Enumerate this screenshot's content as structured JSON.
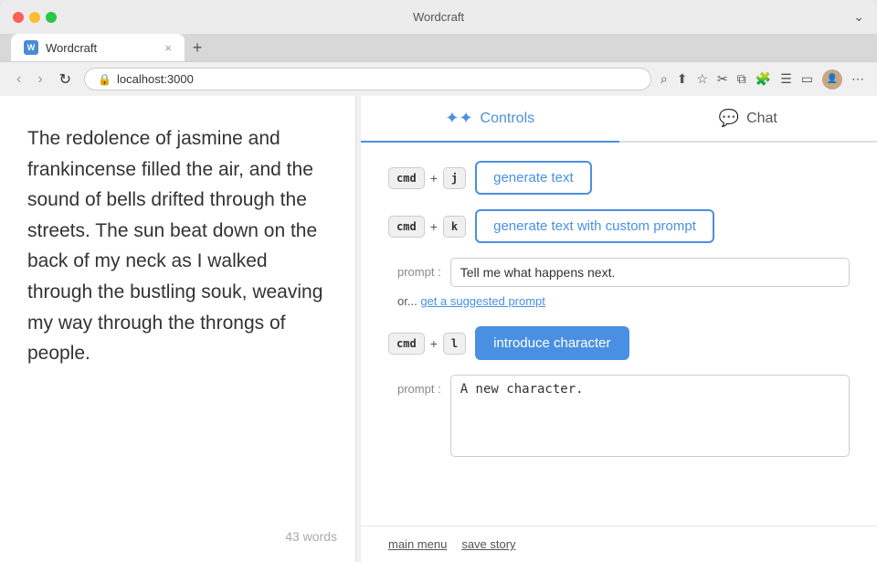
{
  "browser": {
    "tab_title": "Wordcraft",
    "url": "localhost:3000",
    "new_tab_label": "+",
    "tab_close": "×"
  },
  "nav": {
    "back": "‹",
    "forward": "›",
    "reload": "↻"
  },
  "toolbar": {
    "search_icon": "⌕",
    "share_icon": "⬆",
    "bookmark_icon": "★",
    "scissors_icon": "✂",
    "copy_icon": "⧉",
    "ext_icon": "🧩",
    "list_icon": "☰",
    "window_icon": "▭",
    "more_icon": "⋯"
  },
  "text_panel": {
    "story": "The redolence of jasmine and frankincense filled the air, and the sound of bells drifted through the streets. The sun beat down on the back of my neck as I walked through the bustling souk, weaving my way through the throngs of people.",
    "word_count": "43 words"
  },
  "controls": {
    "tab_controls_label": "Controls",
    "tab_chat_label": "Chat",
    "generate_text_label": "generate text",
    "generate_text_custom_label": "generate text with custom prompt",
    "introduce_character_label": "introduce character",
    "cmd_key": "cmd",
    "plus": "+",
    "key_j": "j",
    "key_k": "k",
    "key_l": "l",
    "prompt_label": "prompt :",
    "prompt_value": "Tell me what happens next.",
    "or_text": "or...",
    "suggest_link": "get a suggested prompt",
    "character_prompt_value": "A new character.",
    "main_menu_label": "main menu",
    "save_story_label": "save story"
  },
  "icons": {
    "controls_sparkle": "✦",
    "chat_bubble": "💬"
  }
}
